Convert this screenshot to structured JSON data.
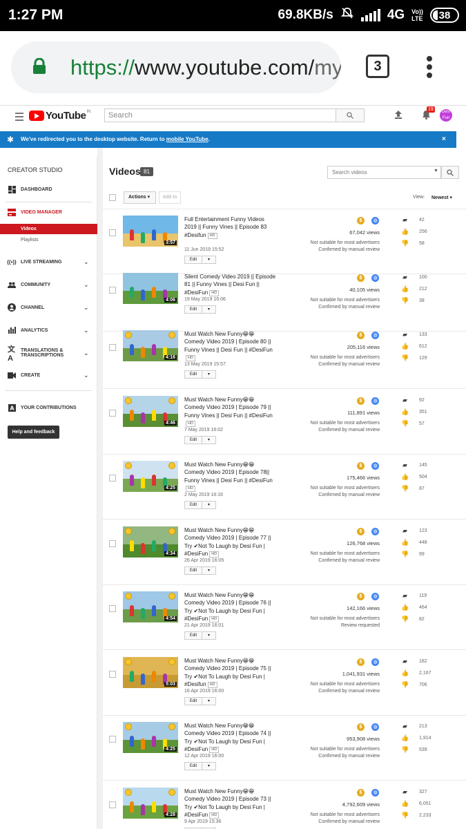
{
  "status": {
    "time": "1:27 PM",
    "speed": "69.8KB/s",
    "network": "4G",
    "volte_top": "Vo))",
    "volte_bottom": "LTE",
    "battery": "38"
  },
  "browser": {
    "url_scheme": "https://",
    "url_host": "www.youtube.com/",
    "url_path": "my",
    "tab_count": "3"
  },
  "youtube": {
    "logo_text": "YouTube",
    "country": "IN",
    "search_placeholder": "Search",
    "notif_count": "19",
    "avatar_text": "Desi Fun"
  },
  "banner": {
    "text": "We've redirected you to the desktop website. Return to",
    "link": "mobile YouTube",
    "close": "×"
  },
  "sidebar": {
    "title": "CREATOR STUDIO",
    "dashboard": "DASHBOARD",
    "video_manager": "VIDEO MANAGER",
    "videos": "Videos",
    "playlists": "Playlists",
    "live": "LIVE STREAMING",
    "community": "COMMUNITY",
    "channel": "CHANNEL",
    "analytics": "ANALYTICS",
    "translations_1": "TRANSLATIONS &",
    "translations_2": "TRANSCRIPTIONS",
    "create": "CREATE",
    "contributions": "YOUR CONTRIBUTIONS",
    "help": "Help and feedback"
  },
  "main": {
    "title": "Videos",
    "count": "81",
    "search_placeholder": "Search videos",
    "actions": "Actions",
    "add_to": "Add to",
    "view_label": "View:",
    "view_value": "Newest",
    "edit": "Edit"
  },
  "videos": [
    {
      "title": "Full Entertainment Funny Videos 2019 || Funny Vines || Episode 83 #Desifun",
      "hd": "HD",
      "date": "11 Jun 2019 15:52",
      "duration": "3:57",
      "views": "67,042 views",
      "ads": "Not suitable for most advertisers",
      "review": "Confirmed by manual review",
      "comments": "42",
      "likes": "256",
      "dislikes": "58"
    },
    {
      "title": "Silent Comedy Video 2019 || Episode 81 || Funny Vines || Desi Fun || #DesiFun",
      "hd": "HD",
      "date": "19 May 2019 16:06",
      "duration": "4:06",
      "views": "40,105 views",
      "ads": "Not suitable for most advertisers",
      "review": "Confirmed by manual review",
      "comments": "100",
      "likes": "212",
      "dislikes": "38"
    },
    {
      "title": "Must Watch New Funny😁😁 Comedy Video 2019 | Episode 80 || Funny Vines || Desi Fun || #DesiFun",
      "hd": "HD",
      "date": "13 May 2019 15:57",
      "duration": "4:16",
      "views": "205,116 views",
      "ads": "Not suitable for most advertisers",
      "review": "Confirmed by manual review",
      "comments": "133",
      "likes": "612",
      "dislikes": "129"
    },
    {
      "title": "Must Watch New Funny😁😁 Comedy Video 2019 | Episode 79 || Funny Vines || Desi Fun || #DesiFun",
      "hd": "HD",
      "date": "7 May 2019 16:02",
      "duration": "4:46",
      "views": "111,891 views",
      "ads": "Not suitable for most advertisers",
      "review": "Confirmed by manual review",
      "comments": "92",
      "likes": "351",
      "dislikes": "57"
    },
    {
      "title": "Must Watch New Funny😁😁 Comedy Video 2019 | Episode 78|| Funny Vines || Desi Fun || #DesiFun",
      "hd": "HD",
      "date": "2 May 2019 16:16",
      "duration": "4:25",
      "views": "175,466 views",
      "ads": "Not suitable for most advertisers",
      "review": "Confirmed by manual review",
      "comments": "145",
      "likes": "504",
      "dislikes": "87"
    },
    {
      "title": "Must Watch New Funny😁😁 Comedy Video 2019 | Episode 77 || Try ✔Not To Laugh by Desi Fun | #DesiFun",
      "hd": "HD",
      "date": "26 Apr 2019 16:05",
      "duration": "4:34",
      "views": "126,768 views",
      "ads": "Not suitable for most advertisers",
      "review": "Confirmed by manual review",
      "comments": "123",
      "likes": "448",
      "dislikes": "99"
    },
    {
      "title": "Must Watch New Funny😁😁 Comedy Video 2019 | Episode 76 || Try ✔Not To Laugh by Desi Fun | #DesiFun",
      "hd": "HD",
      "date": "21 Apr 2019 16:01",
      "duration": "4:54",
      "views": "142,166 views",
      "ads": "Not suitable for most advertisers",
      "review": "Review requested",
      "comments": "119",
      "likes": "464",
      "dislikes": "82"
    },
    {
      "title": "Must Watch New Funny😁😁 Comedy Video 2019 | Episode 75 || Try ✔Not To Laugh by Desi Fun | #Desifun",
      "hd": "HD",
      "date": "16 Apr 2019 16:00",
      "duration": "5:03",
      "views": "1,041,931 views",
      "ads": "Not suitable for most advertisers",
      "review": "Confirmed by manual review",
      "comments": "182",
      "likes": "2,167",
      "dislikes": "706"
    },
    {
      "title": "Must Watch New Funny😁😁 Comedy Video 2019 | Episode 74 || Try ✔Not To Laugh by Desi Fun | #DesiFun",
      "hd": "HD",
      "date": "12 Apr 2019 16:00",
      "duration": "4:25",
      "views": "953,908 views",
      "ads": "Not suitable for most advertisers",
      "review": "Confirmed by manual review",
      "comments": "213",
      "likes": "1,914",
      "dislikes": "539"
    },
    {
      "title": "Must Watch New Funny😁😁 Comedy Video 2019 | Episode 73 || Try ✔Not To Laugh by Desi Fun | #DesiFun",
      "hd": "HD",
      "date": "9 Apr 2019 15:36",
      "duration": "4:28",
      "views": "4,792,609 views",
      "ads": "Not suitable for most advertisers",
      "review": "Confirmed by manual review",
      "comments": "327",
      "likes": "6,051",
      "dislikes": "2,233"
    }
  ]
}
